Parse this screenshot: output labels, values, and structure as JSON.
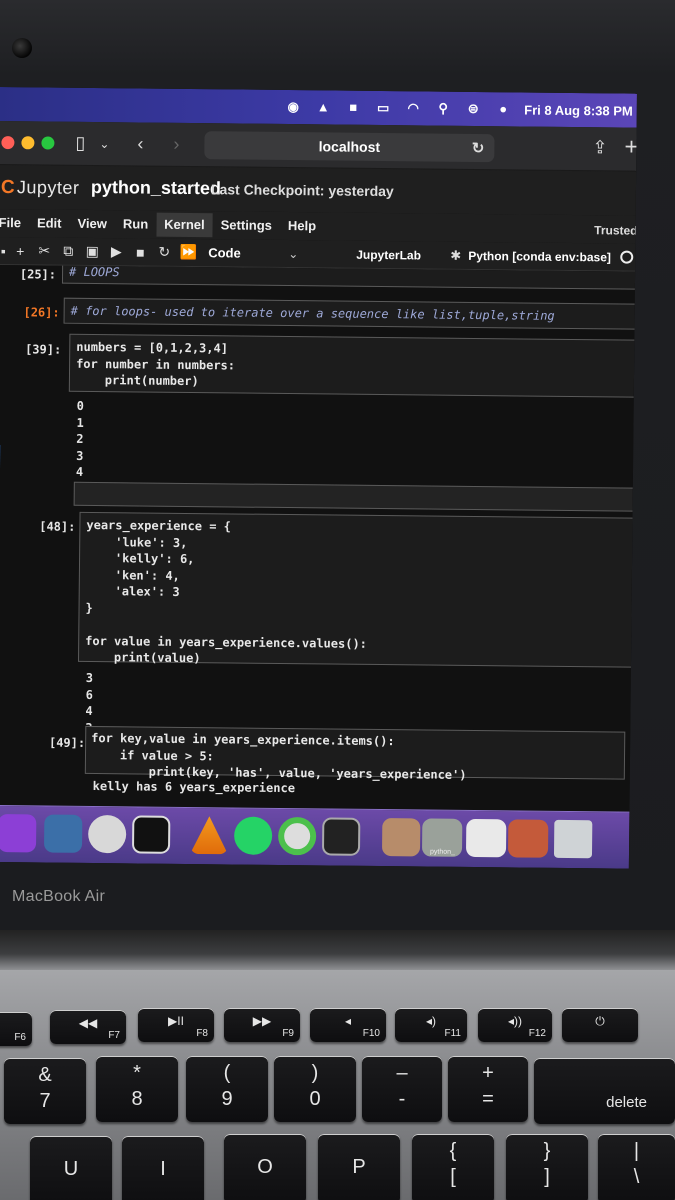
{
  "menubar": {
    "clock": "Fri 8 Aug  8:38 PM"
  },
  "browser": {
    "url": "localhost"
  },
  "jupyter": {
    "app_name": "Jupyter",
    "notebook_title": "python_started",
    "checkpoint": "Last Checkpoint: yesterday",
    "menu": [
      "File",
      "Edit",
      "View",
      "Run",
      "Kernel",
      "Settings",
      "Help"
    ],
    "trusted": "Trusted",
    "cell_type": "Code",
    "jupyterlab_link": "JupyterLab",
    "kernel": "Python [conda env:base]"
  },
  "cells": [
    {
      "prompt": "[25]:",
      "code": "# LOOPS"
    },
    {
      "prompt": "[26]:",
      "code": "# for loops- used to iterate over a sequence like list,tuple,string"
    },
    {
      "prompt": "[39]:",
      "code_lines": [
        "numbers = [0,1,2,3,4]",
        "for number in numbers:",
        "    print(number)"
      ],
      "output": [
        "0",
        "1",
        "2",
        "3",
        "4"
      ]
    },
    {
      "prompt": "[48]:",
      "code_lines": [
        "years_experience = {",
        "    'luke': 3,",
        "    'kelly': 6,",
        "    'ken': 4,",
        "    'alex': 3",
        "}",
        "",
        "for value in years_experience.values():",
        "    print(value)"
      ],
      "output": [
        "3",
        "6",
        "4",
        "3"
      ]
    },
    {
      "prompt": "[49]:",
      "code_lines": [
        "for key,value in years_experience.items():",
        "    if value > 5:",
        "        print(key, 'has', value, 'years_experience')"
      ],
      "output": [
        "kelly has 6 years_experience"
      ]
    }
  ],
  "dock": {
    "running_label": "python_"
  },
  "laptop": {
    "brand": "MacBook Air"
  },
  "keyboard": {
    "fn_keys": [
      "F6",
      "F7",
      "F8",
      "F9",
      "F10",
      "F11",
      "F12"
    ],
    "number_row": [
      {
        "top": "&",
        "bottom": "7"
      },
      {
        "top": "*",
        "bottom": "8"
      },
      {
        "top": "(",
        "bottom": "9"
      },
      {
        "top": ")",
        "bottom": "0"
      },
      {
        "top": "–",
        "bottom": "-"
      },
      {
        "top": "+",
        "bottom": "="
      }
    ],
    "delete": "delete",
    "letter_row": [
      "U",
      "I",
      "O",
      "P"
    ],
    "bracket_keys": [
      {
        "top": "{",
        "bottom": "["
      },
      {
        "top": "}",
        "bottom": "]"
      },
      {
        "top": "|",
        "bottom": "\\"
      }
    ]
  },
  "colors": {
    "jupyter_orange": "#f37726",
    "menubar": "#3d3aa6",
    "code_keyword": "#5ec45e",
    "code_string": "#d7a04a",
    "comment": "#9ea9d8"
  }
}
